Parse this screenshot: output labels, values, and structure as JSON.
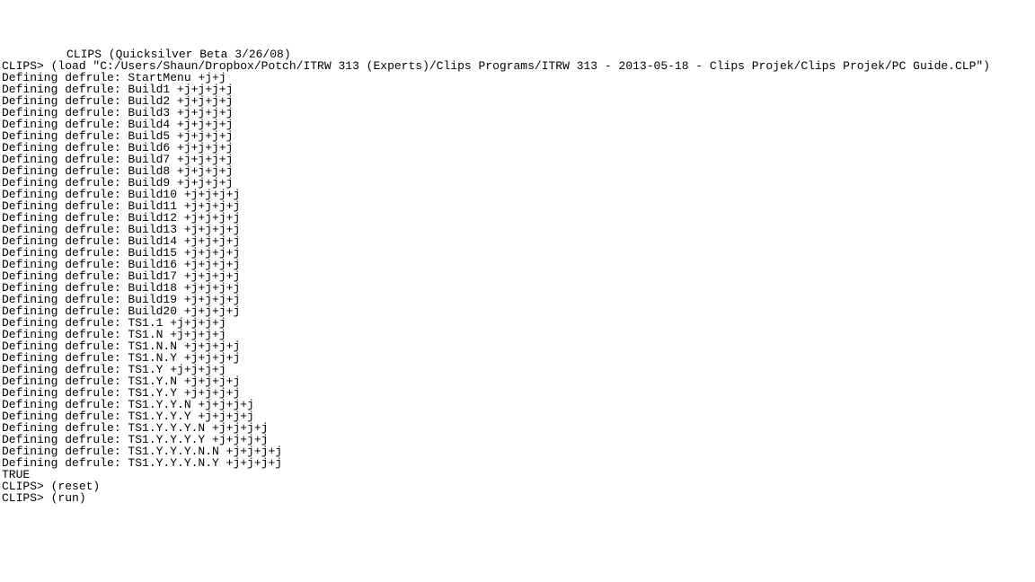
{
  "header": "CLIPS (Quicksilver Beta 3/26/08)",
  "loadLine": "CLIPS> (load \"C:/Users/Shaun/Dropbox/Potch/ITRW 313 (Experts)/Clips Programs/ITRW 313 - 2013-05-18 - Clips Projek/Clips Projek/PC Guide.CLP\")",
  "defrules": [
    "Defining defrule: StartMenu +j+j",
    "Defining defrule: Build1 +j+j+j+j",
    "Defining defrule: Build2 +j+j+j+j",
    "Defining defrule: Build3 +j+j+j+j",
    "Defining defrule: Build4 +j+j+j+j",
    "Defining defrule: Build5 +j+j+j+j",
    "Defining defrule: Build6 +j+j+j+j",
    "Defining defrule: Build7 +j+j+j+j",
    "Defining defrule: Build8 +j+j+j+j",
    "Defining defrule: Build9 +j+j+j+j",
    "Defining defrule: Build10 +j+j+j+j",
    "Defining defrule: Build11 +j+j+j+j",
    "Defining defrule: Build12 +j+j+j+j",
    "Defining defrule: Build13 +j+j+j+j",
    "Defining defrule: Build14 +j+j+j+j",
    "Defining defrule: Build15 +j+j+j+j",
    "Defining defrule: Build16 +j+j+j+j",
    "Defining defrule: Build17 +j+j+j+j",
    "Defining defrule: Build18 +j+j+j+j",
    "Defining defrule: Build19 +j+j+j+j",
    "Defining defrule: Build20 +j+j+j+j",
    "Defining defrule: TS1.1 +j+j+j+j",
    "Defining defrule: TS1.N +j+j+j+j",
    "Defining defrule: TS1.N.N +j+j+j+j",
    "Defining defrule: TS1.N.Y +j+j+j+j",
    "Defining defrule: TS1.Y +j+j+j+j",
    "Defining defrule: TS1.Y.N +j+j+j+j",
    "Defining defrule: TS1.Y.Y +j+j+j+j",
    "Defining defrule: TS1.Y.Y.N +j+j+j+j",
    "Defining defrule: TS1.Y.Y.Y +j+j+j+j",
    "Defining defrule: TS1.Y.Y.Y.N +j+j+j+j",
    "Defining defrule: TS1.Y.Y.Y.Y +j+j+j+j",
    "Defining defrule: TS1.Y.Y.Y.N.N +j+j+j+j",
    "Defining defrule: TS1.Y.Y.Y.N.Y +j+j+j+j"
  ],
  "true": "TRUE",
  "resetLine": "CLIPS> (reset)",
  "runLine": "CLIPS> (run)"
}
